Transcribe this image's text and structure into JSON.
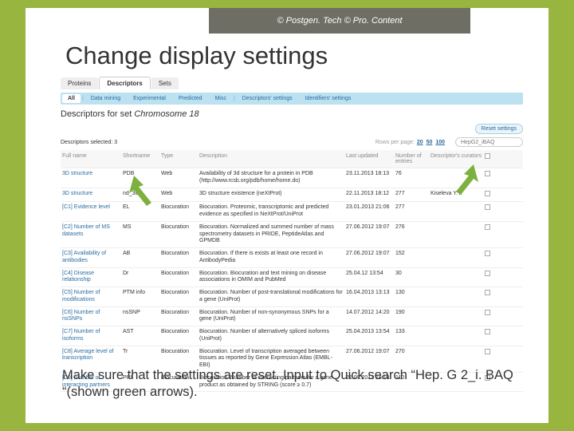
{
  "copyright": "© Postgen. Tech © Pro. Content",
  "heading": "Change display settings",
  "tabs_top": [
    "Proteins",
    "Descriptors",
    "Sets"
  ],
  "subtabs": [
    "All",
    "Data mining",
    "Experimental",
    "Predicted",
    "Misc",
    "Descriptors' settings",
    "Identifiers' settings"
  ],
  "set_title_pre": "Descriptors for set ",
  "set_title_name": "Chromosome 18",
  "reset": "Reset settings",
  "sel_label": "Descriptors selected: 3",
  "rpp_label": "Rows per page:",
  "rpp_vals": [
    "20",
    "50",
    "100"
  ],
  "search_val": "HepG2_iBAQ",
  "headers": [
    "Full name",
    "Shortname",
    "Type",
    "Description",
    "Last updated",
    "Number of entries",
    "Descriptor's curators",
    ""
  ],
  "rows": [
    {
      "fn": "3D structure",
      "sn": "PDB",
      "ty": "Web",
      "de": "Availability of 3d structure for a protein in PDB (http://www.rcsb.org/pdb/home/home.do)",
      "lu": "23.11.2013 18:13",
      "ne": "76",
      "cu": ""
    },
    {
      "fn": "3D structure",
      "sn": "nd_3d",
      "ty": "Web",
      "de": "3D structure existence (neXtProt)",
      "lu": "22.11.2013 18:12",
      "ne": "277",
      "cu": "Kiseleva Y.Y."
    },
    {
      "fn": "[C1] Evidence level",
      "sn": "EL",
      "ty": "Biocuration",
      "de": "Biocuration. Proteomic, transcriptomic and predicted evidence as specified in NeXtProt/UniProt",
      "lu": "23.01.2013 21:06",
      "ne": "277",
      "cu": ""
    },
    {
      "fn": "[C2] Number of MS datasets",
      "sn": "MS",
      "ty": "Biocuration",
      "de": "Biocuration. Normalized and summed number of mass spectrometry datasets in PRIDE, PeptideAtlas and GPMDB",
      "lu": "27.06.2012 19:07",
      "ne": "276",
      "cu": ""
    },
    {
      "fn": "[C3] Availability of antibodies",
      "sn": "AB",
      "ty": "Biocuration",
      "de": "Biocuration. If there is exists at least one record in AntibodyPedia",
      "lu": "27.06.2012 19:07",
      "ne": "152",
      "cu": ""
    },
    {
      "fn": "[C4] Disease relationship",
      "sn": "Dr",
      "ty": "Biocuration",
      "de": "Biocuration. Biocuration and text mining on disease associations in OMIM and PubMed",
      "lu": "25.04.12 13:54",
      "ne": "30",
      "cu": ""
    },
    {
      "fn": "[C5] Number of modifications",
      "sn": "PTM info",
      "ty": "Biocuration",
      "de": "Biocuration. Number of post-translational modifications for a gene (UniProt)",
      "lu": "16.04.2013 13:13",
      "ne": "130",
      "cu": ""
    },
    {
      "fn": "[C6] Number of nsSNPs",
      "sn": "nsSNP",
      "ty": "Biocuration",
      "de": "Biocuration. Number of non-synonymous SNPs for a gene (UniProt)",
      "lu": "14.07.2012 14:20",
      "ne": "190",
      "cu": ""
    },
    {
      "fn": "[C7] Number of isoforms",
      "sn": "AST",
      "ty": "Biocuration",
      "de": "Biocuration. Number of alternatively spliced isoforms (UniProt)",
      "lu": "25.04.2013 13:54",
      "ne": "133",
      "cu": ""
    },
    {
      "fn": "[C8] Average level of transcription",
      "sn": "Tr",
      "ty": "Biocuration",
      "de": "Biocuration. Level of transcription averaged between tissues as reported by Gene Expression Atlas (EMBL-EBI)",
      "lu": "27.06.2012 19:07",
      "ne": "270",
      "cu": ""
    },
    {
      "fn": "[C9] Number of interacting partners",
      "sn": "PPI",
      "ty": "Biocuration",
      "de": "Biocuration. Number of interacting partners for a gene product as obtained by STRING (score ≥ 0.7)",
      "lu": "21.09.2013 18:13",
      "ne": "110",
      "cu": ""
    }
  ],
  "footer_text": "Make sure that the settings are reset. Input to Quick search “Hep. G 2_i. BAQ “(shown green arrows)."
}
